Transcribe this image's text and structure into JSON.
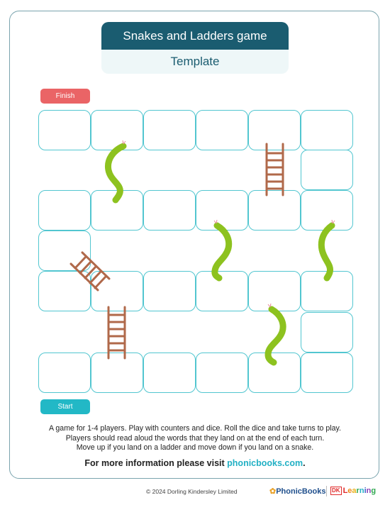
{
  "header": {
    "title": "Snakes and Ladders game",
    "subtitle": "Template"
  },
  "board": {
    "finish_label": "Finish",
    "start_label": "Start",
    "layout_rows": [
      [
        1,
        1,
        1,
        1,
        1,
        1
      ],
      [
        0,
        0,
        0,
        0,
        0,
        1
      ],
      [
        1,
        1,
        1,
        1,
        1,
        1
      ],
      [
        1,
        0,
        0,
        0,
        0,
        0
      ],
      [
        1,
        1,
        1,
        1,
        1,
        1
      ],
      [
        0,
        0,
        0,
        0,
        0,
        1
      ],
      [
        1,
        1,
        1,
        1,
        1,
        1
      ]
    ],
    "snakes_count": 4,
    "ladders_count": 3
  },
  "instructions": {
    "line1": "A game for 1-4 players. Play with counters and dice. Roll the dice and take turns to play.",
    "line2": "Players should read aloud the words that they land on at the end of each turn.",
    "line3": "Move up if you land on a ladder and move down if you land on a snake."
  },
  "more_info": {
    "prefix": "For more information please visit ",
    "link": "phonicbooks.com",
    "suffix": "."
  },
  "footer": {
    "copyright": "© 2024 Dorling Kindersley Limited",
    "logo_phonicbooks": "PhonicBooks",
    "logo_dk": "DK",
    "logo_learning": "Learning"
  },
  "colors": {
    "header_dark": "#1a5c70",
    "header_light": "#eef7f8",
    "finish": "#ea6466",
    "start": "#22b8c6",
    "cell_border": "#52c6d0",
    "snake": "#8dc21f",
    "ladder": "#b0694a"
  }
}
